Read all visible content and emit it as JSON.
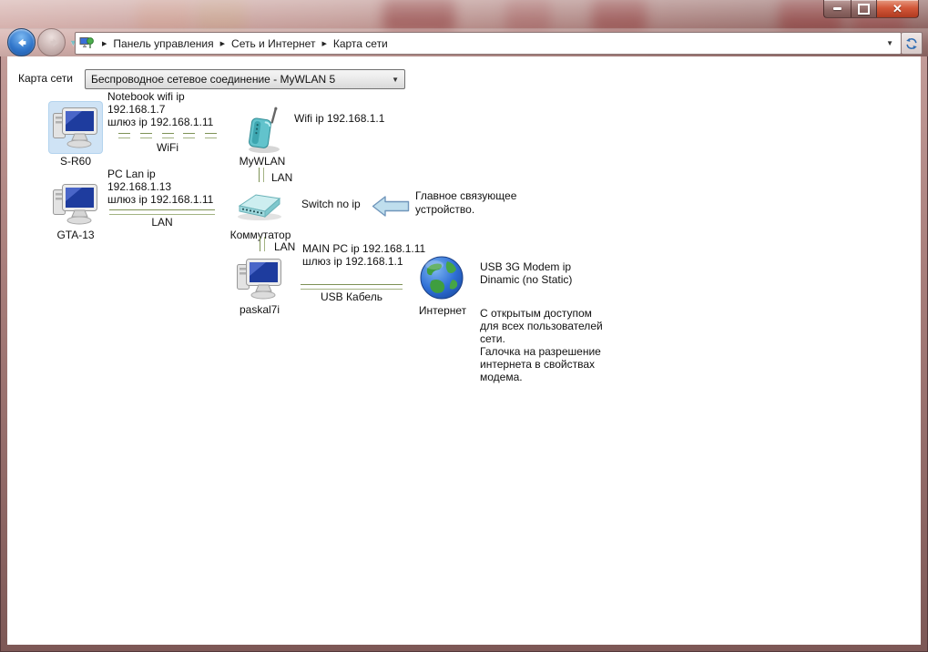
{
  "window": {
    "close_glyph": "✕"
  },
  "toolbar": {
    "breadcrumb": [
      "Панель управления",
      "Сеть и Интернет",
      "Карта сети"
    ],
    "separator_glyph": "▶",
    "dropdown_glyph": "▼",
    "recent_dropdown_glyph": "▼"
  },
  "map": {
    "selector_label": "Карта сети",
    "selector_value": "Беспроводное сетевое соединение - MyWLAN  5",
    "devices": {
      "s_r60": {
        "name": "S-R60",
        "note": "Notebook wifi ip\n192.168.1.7\nшлюз ip 192.168.1.11"
      },
      "gta_13": {
        "name": "GTA-13",
        "note": "PC Lan ip\n192.168.1.13\nшлюз ip 192.168.1.11"
      },
      "mywlan": {
        "name": "MyWLAN",
        "note": "Wifi ip 192.168.1.1"
      },
      "kommutator": {
        "name": "Коммутатор",
        "note": "Switch no ip",
        "annotation": "Главное связующее\nустройство."
      },
      "paskal7i": {
        "name": "paskal7i",
        "note": "MAIN PC ip 192.168.1.11\nшлюз ip 192.168.1.1"
      },
      "internet": {
        "name": "Интернет",
        "note": "USB 3G Modem ip\nDinamic (no Static)",
        "description": "С открытым доступом\nдля всех пользователей\nсети.\nГалочка на разрешение\nинтернета в свойствах\nмодема."
      }
    },
    "links": {
      "wifi": "WiFi",
      "lan_pc": "LAN",
      "lan_router": "LAN",
      "lan_switch": "LAN",
      "usb": "USB Кабель"
    },
    "colors": {
      "link_green_dark": "#7e9256",
      "link_green_light": "#a3b383",
      "arrow_fill": "#bfdeed",
      "arrow_stroke": "#7096bb",
      "selection_blue": "#cfe3f5"
    }
  }
}
